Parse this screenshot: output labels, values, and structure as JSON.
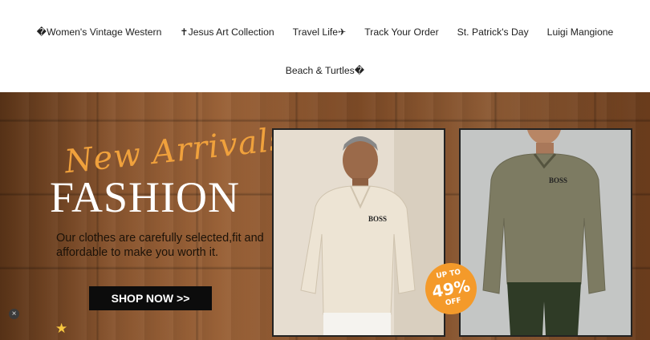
{
  "nav": {
    "row1": [
      "�Women's Vintage Western",
      "✝Jesus Art Collection",
      "Travel Life✈",
      "Track Your Order",
      "St. Patrick's Day",
      "Luigi Mangione"
    ],
    "row2": [
      "Beach & Turtles�"
    ]
  },
  "hero": {
    "headline_script": "New Arrivals",
    "headline": "FASHION",
    "tagline": "Our clothes are carefully selected,fit and affordable to make you worth it.",
    "cta": "SHOP NOW >>",
    "badge": {
      "line1": "UP TO",
      "line2": "49%",
      "line3": "OFF"
    },
    "logo_text_1": "BOSS",
    "logo_text_2": "BOSS"
  },
  "icons": {
    "close": "×",
    "star": "★"
  },
  "colors": {
    "accent": "#f49a2a",
    "headline_script": "#f0a13c",
    "cta_bg": "#0c0c0c"
  }
}
